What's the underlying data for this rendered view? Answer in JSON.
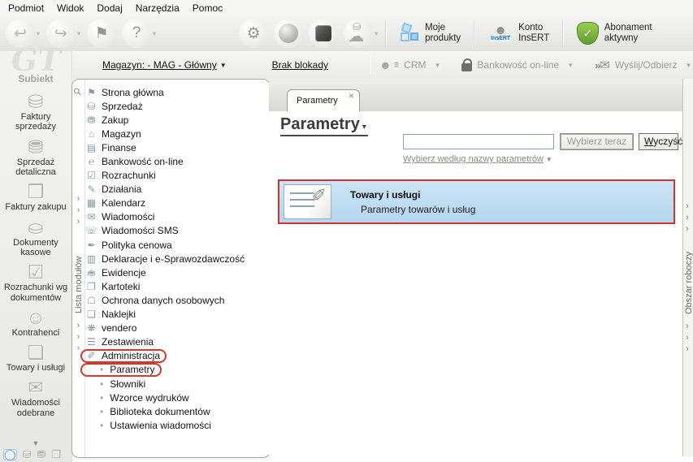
{
  "menu_bar": {
    "items": [
      {
        "label": "Podmiot"
      },
      {
        "label": "Widok"
      },
      {
        "label": "Dodaj"
      },
      {
        "label": "Narzędzia"
      },
      {
        "label": "Pomoc"
      }
    ]
  },
  "icons": {
    "chevron": "›",
    "caret_down": "▾",
    "dropdown_arrow": "▼",
    "close": "×",
    "pin": "⚲",
    "back_arrow": "↩",
    "forward_arrow": "↪",
    "flag": "⚑",
    "help": "?",
    "gear_ring": "⚙",
    "cloud": "☁",
    "coins": "⛁",
    "check": "✓",
    "person": "☻",
    "person_lines": "≡",
    "envelope": "✉",
    "send_arrows": "»",
    "pencil": "✐"
  },
  "toolbar": {
    "my_products_label": "Moje\nprodukty",
    "insert_account_label": "Konto\nInsERT",
    "insert_badge": "InsERT",
    "subscription_label": "Abonament aktywny"
  },
  "subtoolbar": {
    "warehouse_label": "Magazyn: - MAG - Główny",
    "lock_status_label": "Brak blokady",
    "crm_label": "CRM",
    "banking_label": "Bankowość on-line",
    "send_label": "Wyślij/Odbierz"
  },
  "sidebar": {
    "logo_watermark": "GT",
    "app_name": "Subiekt",
    "items": [
      {
        "g": "⛁",
        "label": "Faktury sprzedaży",
        "icon": "sales-invoices-icon"
      },
      {
        "g": "⛃",
        "label": "Sprzedaż detaliczna",
        "icon": "retail-sales-icon"
      },
      {
        "g": "❒",
        "label": "Faktury zakupu",
        "icon": "purchase-invoices-icon"
      },
      {
        "g": "⛀",
        "label": "Dokumenty kasowe",
        "icon": "cash-documents-icon"
      },
      {
        "g": "☑",
        "label": "Rozrachunki wg dokumentów",
        "icon": "settlements-by-documents-icon"
      },
      {
        "g": "☺",
        "label": "Kontrahenci",
        "icon": "contractors-icon"
      },
      {
        "g": "❏",
        "label": "Towary i usługi",
        "icon": "goods-services-icon"
      },
      {
        "g": "✉",
        "label": "Wiadomości odebrane",
        "icon": "inbox-messages-icon"
      }
    ],
    "quick_icons": [
      {
        "g": "◯",
        "icon": "subiekt-quick-icon",
        "css": "active"
      },
      {
        "g": "⛁",
        "icon": "sales-quick-icon",
        "css": ""
      },
      {
        "g": "⛃",
        "icon": "retail-quick-icon",
        "css": ""
      },
      {
        "g": "❒",
        "icon": "purchase-quick-icon",
        "css": ""
      }
    ]
  },
  "module_panel": {
    "vertical_label": "Lista modułów",
    "items": [
      {
        "g": "⚑",
        "label": "Strona główna",
        "icon": "home-icon",
        "css": ""
      },
      {
        "g": "⛁",
        "label": "Sprzedaż",
        "icon": "sales-icon",
        "css": ""
      },
      {
        "g": "⛃",
        "label": "Zakup",
        "icon": "purchase-icon",
        "css": ""
      },
      {
        "g": "⌂",
        "label": "Magazyn",
        "icon": "warehouse-icon",
        "css": ""
      },
      {
        "g": "▤",
        "label": "Finanse",
        "icon": "finance-icon",
        "css": ""
      },
      {
        "g": "℮",
        "label": "Bankowość on-line",
        "icon": "online-banking-icon",
        "css": ""
      },
      {
        "g": "☑",
        "label": "Rozrachunki",
        "icon": "settlements-icon",
        "css": ""
      },
      {
        "g": "✎",
        "label": "Działania",
        "icon": "actions-icon",
        "css": ""
      },
      {
        "g": "▦",
        "label": "Kalendarz",
        "icon": "calendar-icon",
        "css": ""
      },
      {
        "g": "✉",
        "label": "Wiadomości",
        "icon": "messages-icon",
        "css": ""
      },
      {
        "g": "☏",
        "label": "Wiadomości SMS",
        "icon": "sms-messages-icon",
        "css": ""
      },
      {
        "g": "✒",
        "label": "Polityka cenowa",
        "icon": "price-policy-icon",
        "css": ""
      },
      {
        "g": "▥",
        "label": "Deklaracje i e-Sprawozdawczość",
        "icon": "declarations-icon",
        "css": ""
      },
      {
        "g": "⛂",
        "label": "Ewidencje",
        "icon": "records-icon",
        "css": ""
      },
      {
        "g": "❐",
        "label": "Kartoteki",
        "icon": "card-files-icon",
        "css": ""
      },
      {
        "g": "☖",
        "label": "Ochrona danych osobowych",
        "icon": "data-protection-icon",
        "css": ""
      },
      {
        "g": "❏",
        "label": "Naklejki",
        "icon": "labels-icon",
        "css": ""
      },
      {
        "g": "❋",
        "label": "vendero",
        "icon": "vendero-icon",
        "css": ""
      },
      {
        "g": "☰",
        "label": "Zestawienia",
        "icon": "reports-icon",
        "css": ""
      },
      {
        "g": "✐",
        "label": "Administracja",
        "icon": "administration-icon",
        "css": "annotated"
      },
      {
        "label": "Parametry",
        "icon": "bullet-icon",
        "css": "child annotated"
      },
      {
        "label": "Słowniki",
        "icon": "bullet-icon",
        "css": "child"
      },
      {
        "label": "Wzorce wydruków",
        "icon": "bullet-icon",
        "css": "child"
      },
      {
        "label": "Biblioteka dokumentów",
        "icon": "bullet-icon",
        "css": "child"
      },
      {
        "label": "Ustawienia wiadomości",
        "icon": "bullet-icon",
        "css": "child"
      }
    ]
  },
  "main": {
    "tab_label": "Parametry",
    "title": "Parametry",
    "search": {
      "value": "",
      "choose_button": "Wybierz teraz",
      "clear_button_mnemonic": "W",
      "clear_button_rest": "yczyść",
      "filter_link": "Wybierz według nazwy parametrów"
    },
    "selected_item": {
      "title": "Towary i usługi",
      "subtitle": "Parametry towarów i usług"
    }
  },
  "right_panel": {
    "vertical_label": "Obszar roboczy"
  }
}
